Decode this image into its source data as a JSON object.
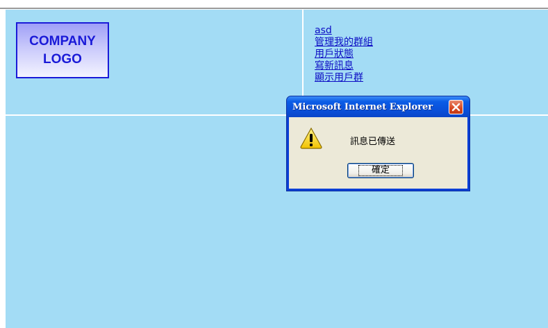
{
  "logo": {
    "line1": "COMPANY",
    "line2": "LOGO"
  },
  "nav": {
    "items": [
      {
        "label": "asd"
      },
      {
        "label": "管理我的群組"
      },
      {
        "label": "用戶狀態"
      },
      {
        "label": "寫新訊息"
      },
      {
        "label": "顯示用戶群"
      }
    ]
  },
  "dialog": {
    "title": "Microsoft Internet Explorer",
    "message": "訊息已傳送",
    "ok_label": "確定",
    "icon": "warning-icon",
    "close_icon": "close-icon"
  },
  "colors": {
    "page_background": "#a3dcf5",
    "link": "#0d0dc4",
    "logo_text": "#1a1ad8",
    "dialog_title": "#0a4fd8",
    "dialog_body": "#ece9d8"
  }
}
